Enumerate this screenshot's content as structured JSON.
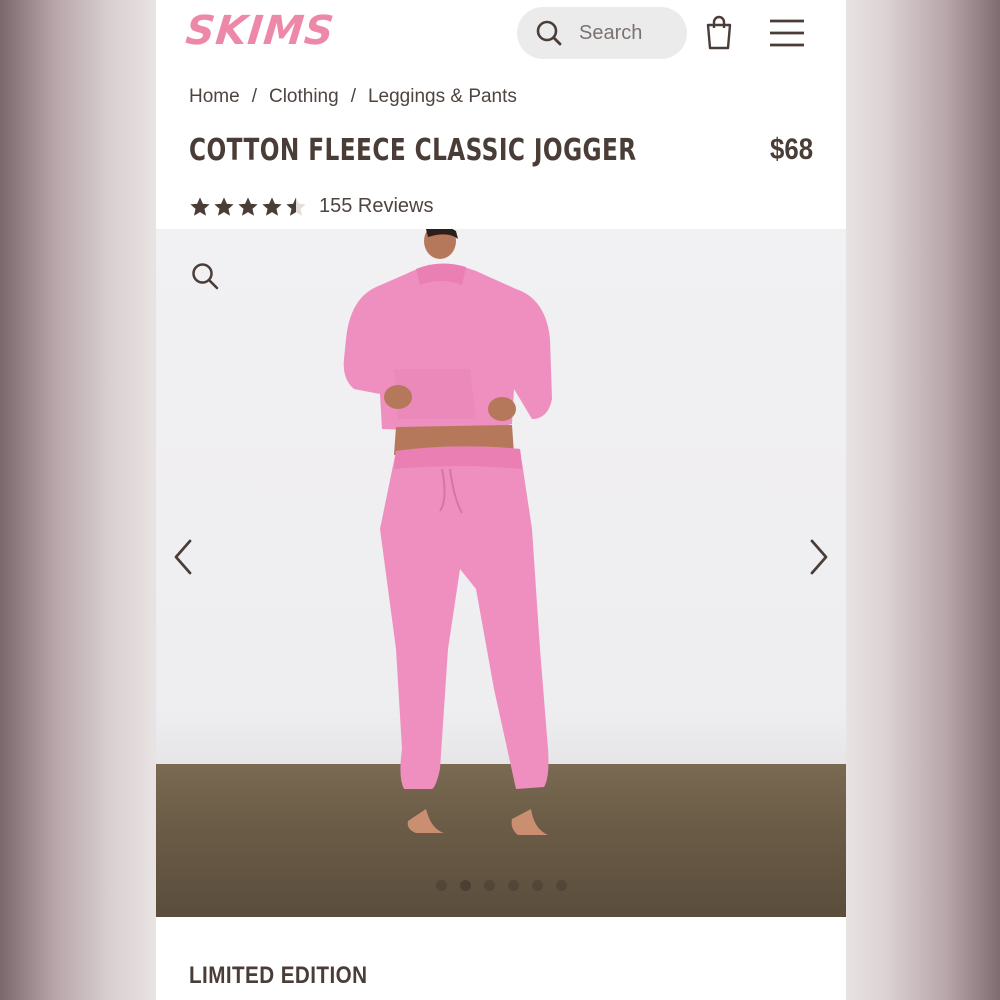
{
  "header": {
    "logo": "SKIMS",
    "search_label": "Search"
  },
  "breadcrumb": {
    "items": [
      "Home",
      "Clothing",
      "Leggings & Pants"
    ],
    "separator": "/"
  },
  "product": {
    "title": "COTTON FLEECE CLASSIC JOGGER",
    "price": "$68",
    "rating": 4.5,
    "reviews": "155 Reviews",
    "badge": "LIMITED EDITION"
  },
  "carousel": {
    "slide_count": 6,
    "active_index": 1
  },
  "colors": {
    "brand_pink": "#ee88a8",
    "text_dark": "#4a3d37",
    "product_pink": "#ef8fbf"
  }
}
